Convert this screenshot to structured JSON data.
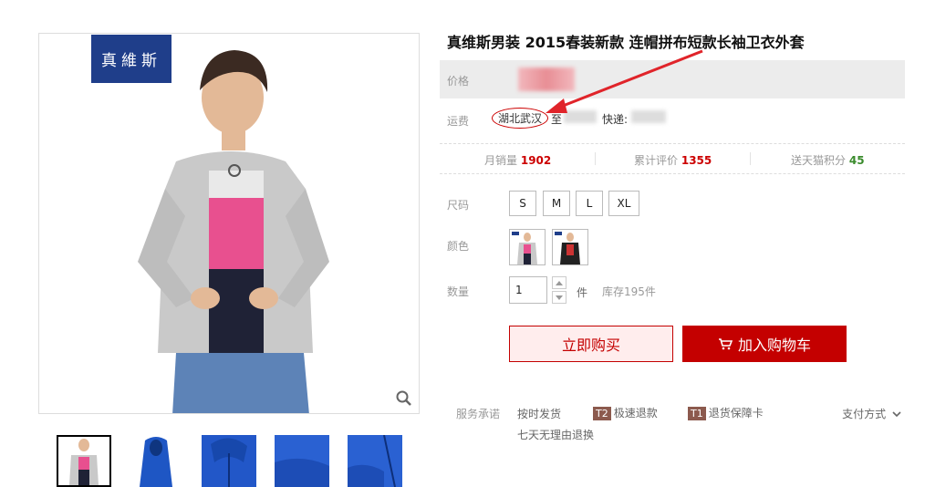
{
  "product": {
    "title": "真维斯男装 2015春装新款 连帽拼布短款长袖卫衣外套",
    "brand_logo_text": "真維斯"
  },
  "price": {
    "label": "价格"
  },
  "shipping": {
    "label": "运费",
    "from": "湖北武汉",
    "to_prefix": "至",
    "express_label": "快递:"
  },
  "stats": {
    "monthly_sales_label": "月销量",
    "monthly_sales_value": "1902",
    "reviews_label": "累计评价",
    "reviews_value": "1355",
    "points_label": "送天猫积分",
    "points_value": "45"
  },
  "size": {
    "label": "尺码",
    "options": [
      "S",
      "M",
      "L",
      "XL"
    ]
  },
  "color": {
    "label": "颜色",
    "options": [
      "gray-hoodie",
      "black-jacket"
    ]
  },
  "quantity": {
    "label": "数量",
    "value": "1",
    "unit": "件",
    "stock": "库存195件"
  },
  "actions": {
    "buy_now": "立即购买",
    "add_to_cart": "加入购物车"
  },
  "services": {
    "label": "服务承诺",
    "items": [
      {
        "badge": "",
        "text": "按时发货"
      },
      {
        "badge": "T2",
        "text": "极速退款"
      },
      {
        "badge": "T1",
        "text": "退货保障卡"
      },
      {
        "badge": "",
        "text": "七天无理由退换"
      }
    ],
    "payment_label": "支付方式"
  },
  "colors": {
    "accent": "#c40000",
    "price_bg": "#ececec",
    "brand_blue": "#1f3e8a",
    "points_green": "#3a8b2c"
  }
}
